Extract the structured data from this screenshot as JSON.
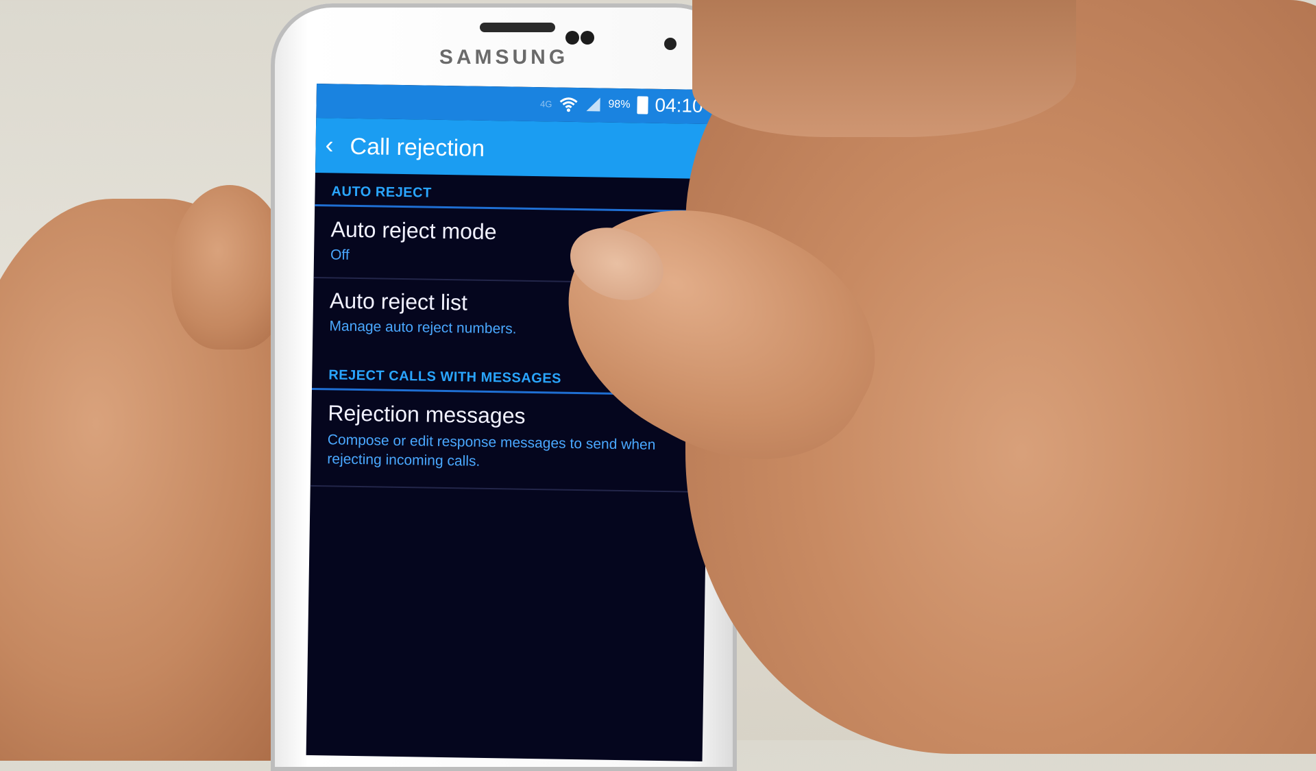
{
  "device": {
    "brand": "SAMSUNG"
  },
  "status_bar": {
    "network": "4G",
    "battery": "98%",
    "time": "04:10"
  },
  "action_bar": {
    "title": "Call rejection"
  },
  "sections": {
    "auto_reject": "AUTO REJECT",
    "reject_messages": "REJECT CALLS WITH MESSAGES"
  },
  "items": {
    "auto_reject_mode": {
      "title": "Auto reject mode",
      "summary": "Off"
    },
    "auto_reject_list": {
      "title": "Auto reject list",
      "summary": "Manage auto reject numbers."
    },
    "rejection_messages": {
      "title": "Rejection messages",
      "summary": "Compose or edit response messages to send when rejecting incoming calls."
    }
  },
  "colors": {
    "status_bar": "#1a83e0",
    "action_bar": "#1b9df2",
    "screen_bg": "#05061e",
    "accent": "#2aa6ff"
  }
}
